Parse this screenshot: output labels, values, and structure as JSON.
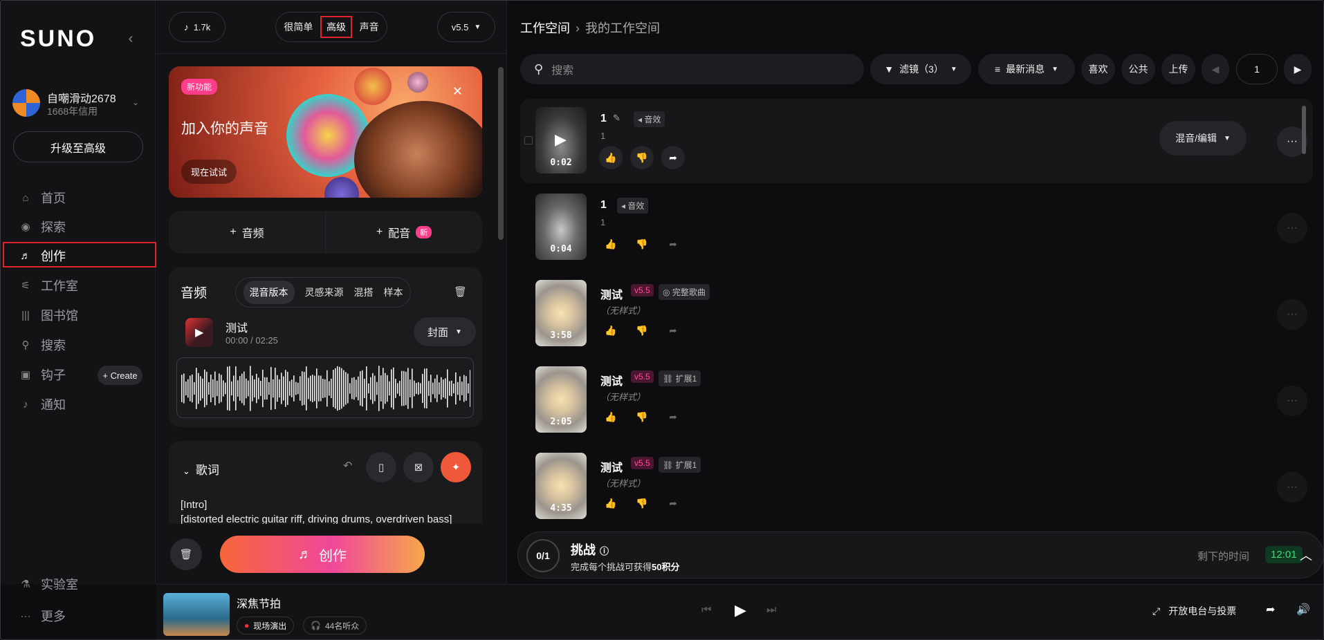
{
  "sidebar": {
    "logo": "SUNO",
    "username": "自嘲滑动2678",
    "credits": "1668年信用",
    "upgrade": "升级至高级",
    "nav": [
      {
        "label": "首页",
        "icon": "home-icon"
      },
      {
        "label": "探索",
        "icon": "compass-icon"
      },
      {
        "label": "创作",
        "icon": "music-note-icon"
      },
      {
        "label": "工作室",
        "icon": "studio-icon"
      },
      {
        "label": "图书馆",
        "icon": "library-icon"
      },
      {
        "label": "搜索",
        "icon": "search-icon"
      },
      {
        "label": "钩子",
        "icon": "hook-icon"
      },
      {
        "label": "通知",
        "icon": "bell-icon"
      }
    ],
    "create_hook": "+ Create",
    "labs": "实验室",
    "more": "更多"
  },
  "create": {
    "note_count": "1.7k",
    "modes": [
      "很简单",
      "高级",
      "声音"
    ],
    "version": "v5.5",
    "banner": {
      "badge": "新功能",
      "title": "加入你的声音",
      "cta": "现在试试"
    },
    "add_audio": "音频",
    "add_voice": "配音",
    "new_tag": "新",
    "audio": {
      "title": "音频",
      "tabs": [
        "混音版本",
        "灵感来源",
        "混搭",
        "样本"
      ],
      "track_name": "测试",
      "track_time": "00:00 / 02:25",
      "cover": "封面"
    },
    "lyrics": {
      "title": "歌词",
      "line1": "[Intro]",
      "line2": "[distorted electric guitar riff, driving drums, overdriven bass]"
    },
    "create_button": "创作"
  },
  "workspace": {
    "crumb_root": "工作空间",
    "crumb_current": "我的工作空间",
    "search_placeholder": "搜索",
    "filter": "滤镜（3）",
    "sort": "最新消息",
    "likes": "喜欢",
    "public": "公共",
    "upload": "上传",
    "page": "1",
    "remix_edit": "混音/编辑",
    "songs": [
      {
        "title": "1",
        "tag": "音效",
        "subtitle": "1",
        "duration": "0:02"
      },
      {
        "title": "1",
        "tag": "音效",
        "subtitle": "1",
        "duration": "0:04"
      },
      {
        "title": "测试",
        "version": "v5.5",
        "tag": "完整歌曲",
        "subtitle": "（无样式）",
        "duration": "3:58"
      },
      {
        "title": "测试",
        "version": "v5.5",
        "tag": "扩展1",
        "subtitle": "（无样式）",
        "duration": "2:05"
      },
      {
        "title": "测试",
        "version": "v5.5",
        "tag": "扩展1",
        "subtitle": "（无样式）",
        "duration": "4:35"
      }
    ]
  },
  "challenge": {
    "progress": "0/1",
    "title": "挑战",
    "desc_prefix": "完成每个挑战可获得",
    "desc_bold": "50积分",
    "time_label": "剩下的时间",
    "time_value": "12:01"
  },
  "player": {
    "title": "深焦节拍",
    "live": "现场演出",
    "listeners": "44名听众",
    "radio": "开放电台与投票"
  }
}
